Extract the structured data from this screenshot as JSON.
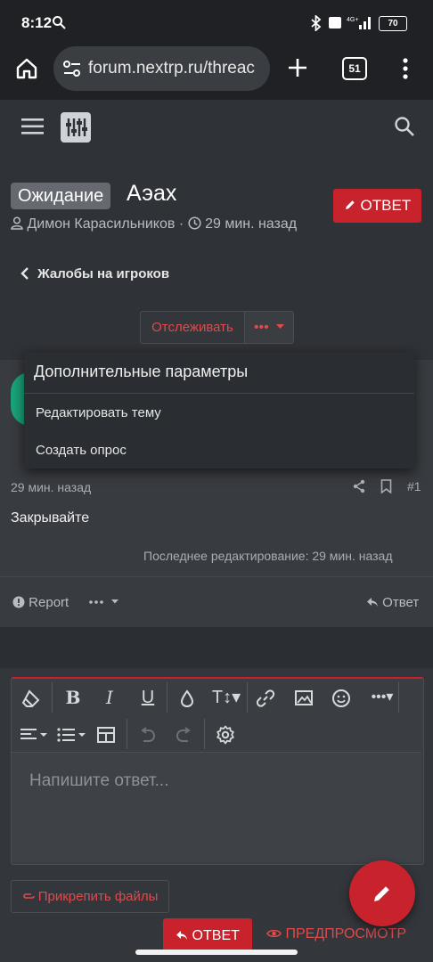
{
  "status": {
    "time": "8:12",
    "battery": "70"
  },
  "browser": {
    "url": "forum.nextrp.ru/threac",
    "tab_count": "51"
  },
  "thread": {
    "badge": "Ожидание",
    "title": "Аэах",
    "reply_label": "ОТВЕТ",
    "author": "Димон Карасильников",
    "time_ago": "29 мин. назад"
  },
  "breadcrumb": "Жалобы на игроков",
  "follow": {
    "label": "Отслеживать",
    "more_label": "•••"
  },
  "menu": {
    "header": "Дополнительные параметры",
    "items": [
      "Редактировать тему",
      "Создать опрос"
    ]
  },
  "post": {
    "time": "29 мин. назад",
    "number": "#1",
    "content": "Закрывайте",
    "edited": "Последнее редактирование: 29 мин. назад",
    "report_label": "Report",
    "reply_label": "Ответ"
  },
  "editor": {
    "placeholder": "Напишите ответ...",
    "attach_label": "Прикрепить файлы",
    "reply_label": "ОТВЕТ",
    "preview_label": "ПРЕДПРОСМОТР"
  },
  "colors": {
    "accent": "#c8232d",
    "background": "#2f3237",
    "menu": "#2a2d31"
  }
}
